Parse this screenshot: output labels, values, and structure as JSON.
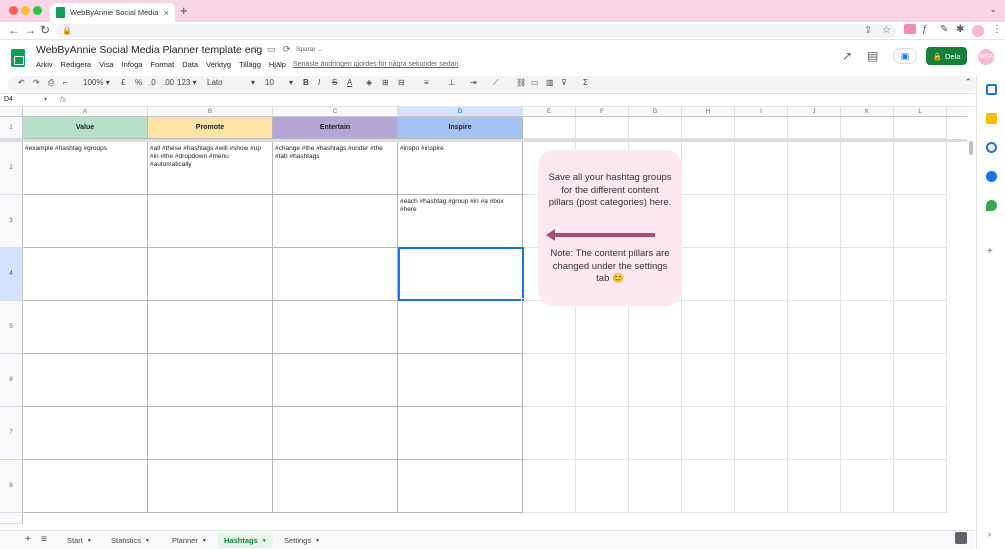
{
  "browser": {
    "tab_title": "WebByAnnie Social Media Plan",
    "tab_close": "×",
    "new_tab": "+"
  },
  "doc": {
    "title": "WebByAnnie Social Media Planner template eng",
    "saving": "Sparar ...",
    "last_edit": "Senaste ändringen gjordes för några sekunder sedan",
    "share_label": "Dela",
    "avatar_initials": "WBA"
  },
  "menu": [
    "Arkiv",
    "Redigera",
    "Visa",
    "Infoga",
    "Format",
    "Data",
    "Verktyg",
    "Tillägg",
    "Hjälp"
  ],
  "toolbar": {
    "zoom": "100%",
    "currency": "£",
    "percent": "%",
    "dec_less": ".0",
    "dec_more": ".00",
    "number_format": "123",
    "font": "Lato",
    "font_size": "10",
    "bold": "B",
    "italic": "I",
    "strike": "S",
    "text_color": "A"
  },
  "formula_bar": {
    "name_box": "D4",
    "fx": "fx"
  },
  "grid": {
    "columns": [
      "A",
      "B",
      "C",
      "D",
      "E",
      "F",
      "G",
      "H",
      "I",
      "J",
      "K",
      "L"
    ],
    "rows": [
      "1",
      "2",
      "3",
      "4",
      "5",
      "6",
      "7",
      "8"
    ],
    "selected_column": "D",
    "selected_row": "4",
    "headers": {
      "value": "Value",
      "promote": "Promote",
      "entertain": "Entertain",
      "inspire": "Inspire"
    },
    "header_colors": {
      "value": "#b7dfcb",
      "promote": "#fde4a6",
      "entertain": "#b4a7d6",
      "inspire": "#a4c2f4"
    },
    "cells": {
      "a2": "#example #hashtag #groups",
      "b2": "#all #these #hashtags #will #show #up #in #the #dropdown #menu #automatically",
      "c2": "#change #the #hashtags #under #the #tab #hashtags",
      "d2": "#inspo #inspire",
      "d3": "#each #hashtag #group #in #a #box #here"
    }
  },
  "callout": {
    "text1": "Save all your hashtag groups for the different content pillars (post categories) here.",
    "text2": "Note: The content pillars are changed under the settings tab 😊",
    "arrow_color": "#a64d79",
    "bg_color": "#fde7f0"
  },
  "sheets": {
    "tabs": [
      "Start",
      "Statistics",
      "Planner",
      "Hashtags",
      "Settings"
    ],
    "active": "Hashtags",
    "add": "+",
    "all_sheets": "≡"
  }
}
